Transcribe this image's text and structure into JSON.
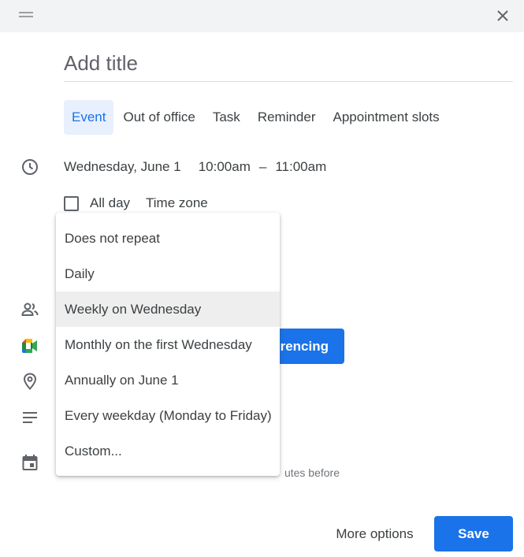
{
  "dialog": {
    "title_placeholder": "Add title"
  },
  "tabs": [
    {
      "label": "Event",
      "active": true
    },
    {
      "label": "Out of office",
      "active": false
    },
    {
      "label": "Task",
      "active": false
    },
    {
      "label": "Reminder",
      "active": false
    },
    {
      "label": "Appointment slots",
      "active": false
    }
  ],
  "datetime": {
    "date": "Wednesday, June 1",
    "start": "10:00am",
    "separator": "–",
    "end": "11:00am"
  },
  "allday": {
    "label": "All day",
    "checked": false,
    "timezone_label": "Time zone"
  },
  "recurrence_menu": {
    "items": [
      "Does not repeat",
      "Daily",
      "Weekly on Wednesday",
      "Monthly on the first Wednesday",
      "Annually on June 1",
      "Every weekday (Monday to Friday)",
      "Custom..."
    ],
    "highlighted": "Weekly on Wednesday"
  },
  "conferencing": {
    "label_visible": "rencing"
  },
  "reminder": {
    "text_visible": "utes before"
  },
  "footer": {
    "more_options": "More options",
    "save": "Save"
  },
  "colors": {
    "accent": "#1a73e8",
    "tab_active_bg": "#e8f0fe",
    "topbar_bg": "#f1f3f4",
    "text": "#3c4043",
    "menu_highlight": "#eeeeee"
  }
}
